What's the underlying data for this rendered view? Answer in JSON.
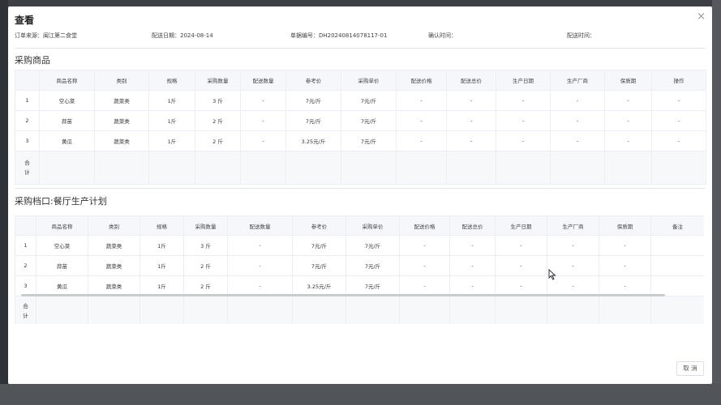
{
  "dialog": {
    "title": "查看",
    "close_glyph": "×",
    "cancel_label": "取 消"
  },
  "meta": {
    "order_source": "订单来源：闽江第二食堂",
    "delivery_date": "配送日期：2024-08-14",
    "doc_number": "单据编号：DH20240814078117-01",
    "confirm_time": "确认时间：",
    "delivery_time": "配送时间："
  },
  "section1": {
    "title": "采购商品",
    "headers": [
      "",
      "商品名称",
      "类别",
      "规格",
      "采购数量",
      "配送数量",
      "参考价",
      "采购单价",
      "配送价格",
      "配送总价",
      "生产日期",
      "生产厂商",
      "保质期",
      "操作"
    ],
    "rows": [
      [
        "1",
        "空心菜",
        "蔬菜类",
        "1斤",
        "3 斤",
        "-",
        "7元/斤",
        "7元/斤",
        "-",
        "-",
        "-",
        "-",
        "-",
        "-"
      ],
      [
        "2",
        "蒜苗",
        "蔬菜类",
        "1斤",
        "2 斤",
        "-",
        "7元/斤",
        "7元/斤",
        "-",
        "-",
        "-",
        "-",
        "-",
        "-"
      ],
      [
        "3",
        "黄瓜",
        "蔬菜类",
        "1斤",
        "2 斤",
        "-",
        "3.25元/斤",
        "7元/斤",
        "-",
        "-",
        "-",
        "-",
        "-",
        "-"
      ]
    ],
    "total_label_1": "合",
    "total_label_2": "计"
  },
  "section2": {
    "title": "采购档口:餐厅生产计划",
    "headers": [
      "",
      "商品名称",
      "类别",
      "规格",
      "采购数量",
      "配送数量",
      "参考价",
      "采购单价",
      "配送价格",
      "配送总价",
      "生产日期",
      "生产厂商",
      "保质期",
      "备注"
    ],
    "rows": [
      [
        "1",
        "空心菜",
        "蔬菜类",
        "1斤",
        "3 斤",
        "-",
        "7元/斤",
        "7元/斤",
        "-",
        "-",
        "-",
        "-",
        "-",
        ""
      ],
      [
        "2",
        "蒜苗",
        "蔬菜类",
        "1斤",
        "2 斤",
        "-",
        "7元/斤",
        "7元/斤",
        "-",
        "-",
        "-",
        "-",
        "-",
        ""
      ],
      [
        "3",
        "黄瓜",
        "蔬菜类",
        "1斤",
        "2 斤",
        "-",
        "3.25元/斤",
        "7元/斤",
        "-",
        "-",
        "-",
        "-",
        "-",
        ""
      ]
    ],
    "total_label_1": "合",
    "total_label_2": "计"
  },
  "icons": {
    "close": "close-icon",
    "cursor": "mouse-pointer-icon"
  }
}
